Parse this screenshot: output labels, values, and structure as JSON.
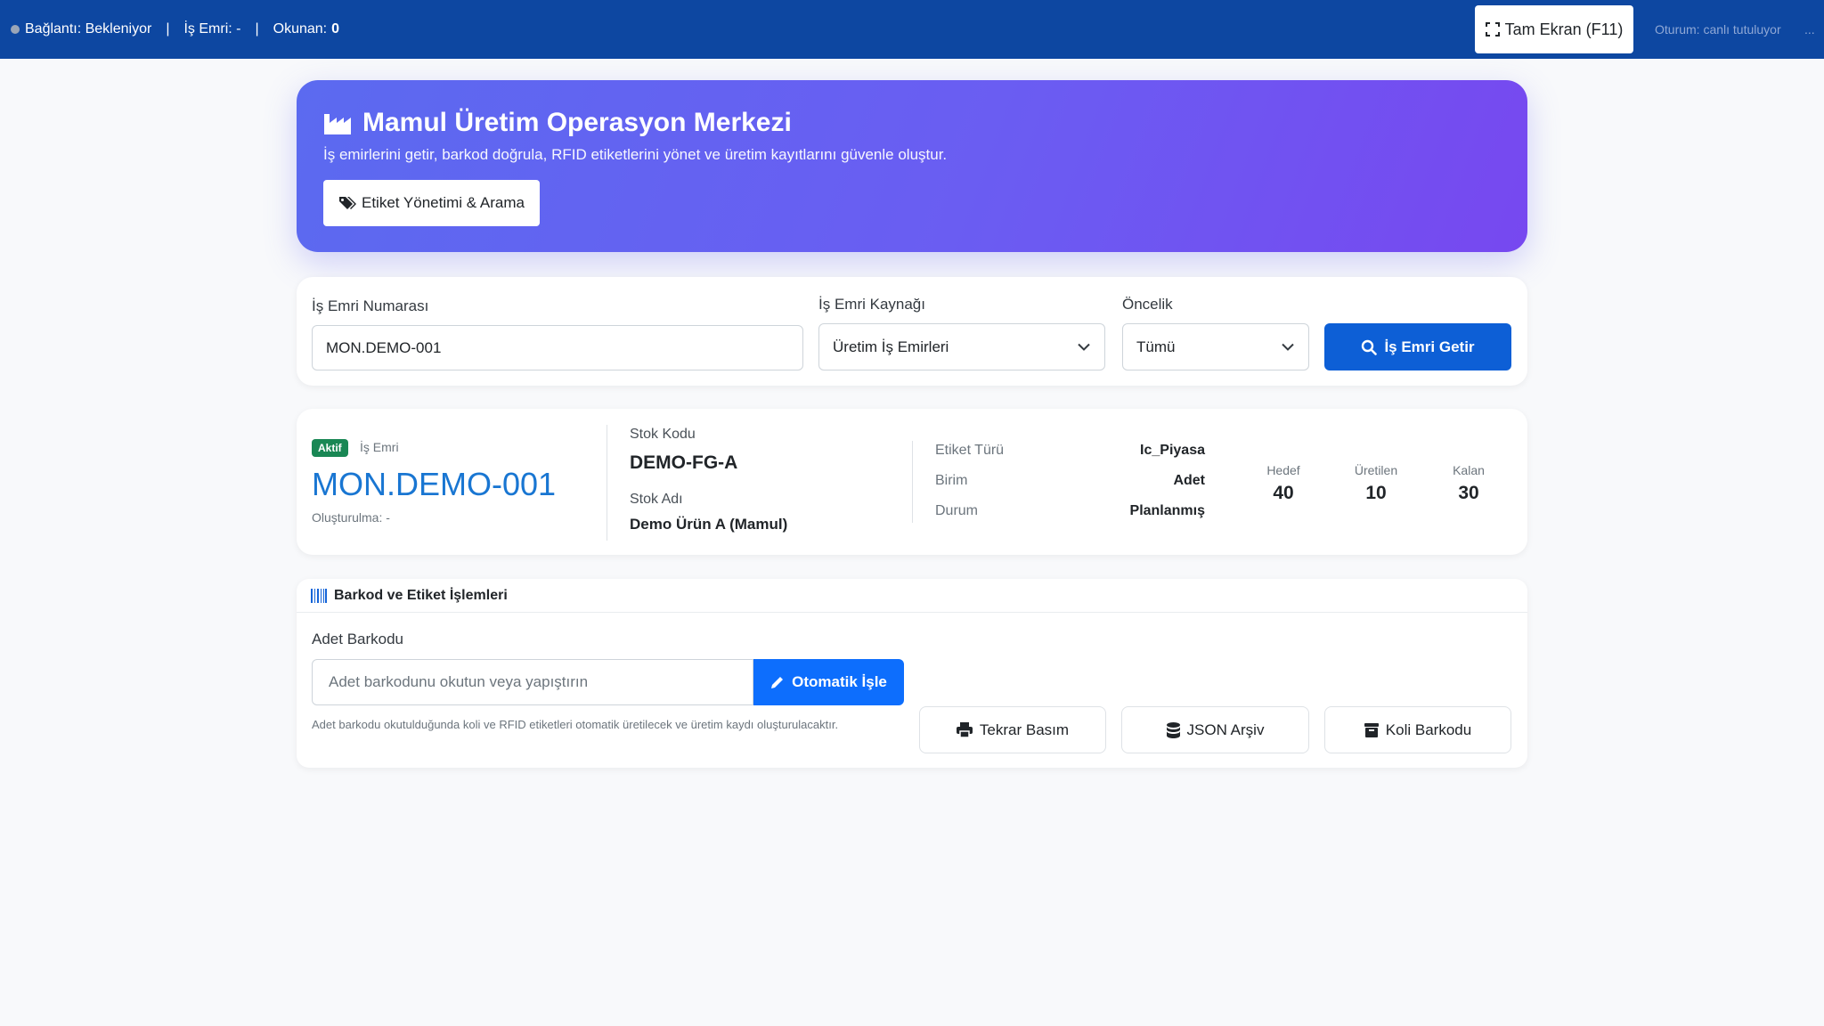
{
  "topbar": {
    "connection": "Bağlantı: Bekleniyor",
    "sep": "|",
    "work_order": "İş Emri: -",
    "read_label": "Okunan:",
    "read_count": "0",
    "fullscreen_label": "Tam Ekran (F11)",
    "session": "Oturum: canlı tutuluyor",
    "more": "..."
  },
  "hero": {
    "title": "Mamul Üretim Operasyon Merkezi",
    "subtitle": "İş emirlerini getir, barkod doğrula, RFID etiketlerini yönet ve üretim kayıtlarını güvenle oluştur.",
    "tag_button": "Etiket Yönetimi & Arama"
  },
  "search": {
    "wo_label": "İş Emri Numarası",
    "wo_value": "MON.DEMO-001",
    "source_label": "İş Emri Kaynağı",
    "source_value": "Üretim İş Emirleri",
    "priority_label": "Öncelik",
    "priority_value": "Tümü",
    "fetch_button": "İş Emri Getir"
  },
  "work_order": {
    "status_badge": "Aktif",
    "type_label": "İş Emri",
    "number": "MON.DEMO-001",
    "created": "Oluşturulma: -",
    "stock_code_label": "Stok Kodu",
    "stock_code": "DEMO-FG-A",
    "stock_name_label": "Stok Adı",
    "stock_name": "Demo Ürün A (Mamul)",
    "details": [
      {
        "label": "Etiket Türü",
        "value": "Ic_Piyasa"
      },
      {
        "label": "Birim",
        "value": "Adet"
      },
      {
        "label": "Durum",
        "value": "Planlanmış"
      }
    ],
    "stats": [
      {
        "label": "Hedef",
        "value": "40"
      },
      {
        "label": "Üretilen",
        "value": "10"
      },
      {
        "label": "Kalan",
        "value": "30"
      }
    ]
  },
  "barcode": {
    "title": "Barkod ve Etiket İşlemleri",
    "qty_label": "Adet Barkodu",
    "qty_placeholder": "Adet barkodunu okutun veya yapıştırın",
    "auto_button": "Otomatik İşle",
    "help_text": "Adet barkodu okutulduğunda koli ve RFID etiketleri otomatik üretilecek ve üretim kaydı oluşturulacaktır.",
    "reprint_button": "Tekrar Basım",
    "json_button": "JSON Arşiv",
    "box_button": "Koli Barkodu"
  }
}
